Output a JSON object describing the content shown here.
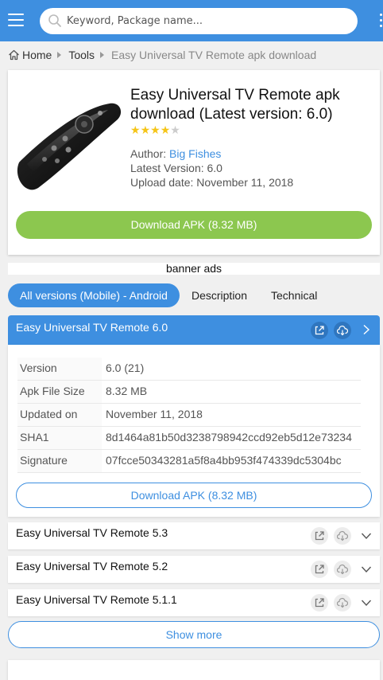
{
  "colors": {
    "brand": "#3e8fe0",
    "download_green": "#8cc74f",
    "star": "#f5c518"
  },
  "header": {
    "search_placeholder": "Keyword, Package name...",
    "icons": [
      "menu-icon",
      "search-icon",
      "more-icon"
    ]
  },
  "breadcrumb": {
    "home": "Home",
    "category": "Tools",
    "current": "Easy Universal TV Remote apk download"
  },
  "app": {
    "title": "Easy Universal TV Remote apk download (Latest version: 6.0)",
    "rating": 4,
    "rating_max": 5,
    "author_label": "Author: ",
    "author": "Big Fishes",
    "latest_version": "Latest Version: 6.0",
    "upload_date": "Upload date: November 11, 2018",
    "download_label": "Download APK (8.32 MB)"
  },
  "banner": "banner ads",
  "tabs": [
    {
      "label": "All versions (Mobile) - Android",
      "active": true
    },
    {
      "label": "Description",
      "active": false
    },
    {
      "label": "Technical",
      "active": false
    }
  ],
  "expanded_version": {
    "name": "Easy Universal TV Remote 6.0",
    "specs": [
      {
        "key": "Version",
        "value": "6.0 (21)"
      },
      {
        "key": "Apk File Size",
        "value": "8.32 MB"
      },
      {
        "key": "Updated on",
        "value": "November 11, 2018"
      },
      {
        "key": "SHA1",
        "value": "8d1464a81b50d3238798942ccd92eb5d12e73234"
      },
      {
        "key": "Signature",
        "value": "07fcce50343281a5f8a4bb953f474339dc5304bc"
      }
    ],
    "download_label": "Download APK (8.32 MB)"
  },
  "other_versions": [
    {
      "name": "Easy Universal TV Remote 5.3"
    },
    {
      "name": "Easy Universal TV Remote 5.2"
    },
    {
      "name": "Easy Universal TV Remote 5.1.1"
    }
  ],
  "show_more": "Show more"
}
